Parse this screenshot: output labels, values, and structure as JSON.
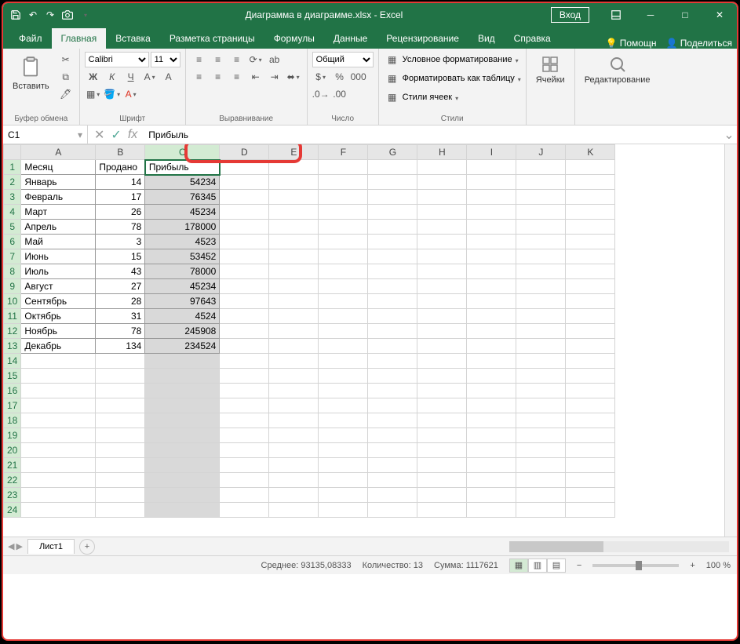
{
  "window": {
    "title": "Диаграмма в диаграмме.xlsx  -  Excel",
    "login": "Вход"
  },
  "tabs": {
    "file": "Файл",
    "home": "Главная",
    "insert": "Вставка",
    "layout": "Разметка страницы",
    "formulas": "Формулы",
    "data": "Данные",
    "review": "Рецензирование",
    "view": "Вид",
    "help": "Справка",
    "tellme": "Помощн",
    "share": "Поделиться"
  },
  "ribbon": {
    "paste": "Вставить",
    "clipboard": "Буфер обмена",
    "font_name": "Calibri",
    "font_size": "11",
    "font": "Шрифт",
    "alignment": "Выравнивание",
    "number_format": "Общий",
    "number": "Число",
    "cond_format": "Условное форматирование",
    "format_table": "Форматировать как таблицу",
    "cell_styles": "Стили ячеек",
    "styles": "Стили",
    "cells": "Ячейки",
    "editing": "Редактирование"
  },
  "formula_bar": {
    "namebox": "C1",
    "value": "Прибыль"
  },
  "columns": [
    "A",
    "B",
    "C",
    "D",
    "E",
    "F",
    "G",
    "H",
    "I",
    "J",
    "K"
  ],
  "headers": {
    "a": "Месяц",
    "b": "Продано",
    "c": "Прибыль"
  },
  "rows": [
    {
      "n": 1
    },
    {
      "n": 2,
      "a": "Январь",
      "b": "14",
      "c": "54234"
    },
    {
      "n": 3,
      "a": "Февраль",
      "b": "17",
      "c": "76345"
    },
    {
      "n": 4,
      "a": "Март",
      "b": "26",
      "c": "45234"
    },
    {
      "n": 5,
      "a": "Апрель",
      "b": "78",
      "c": "178000"
    },
    {
      "n": 6,
      "a": "Май",
      "b": "3",
      "c": "4523"
    },
    {
      "n": 7,
      "a": "Июнь",
      "b": "15",
      "c": "53452"
    },
    {
      "n": 8,
      "a": "Июль",
      "b": "43",
      "c": "78000"
    },
    {
      "n": 9,
      "a": "Август",
      "b": "27",
      "c": "45234"
    },
    {
      "n": 10,
      "a": "Сентябрь",
      "b": "28",
      "c": "97643"
    },
    {
      "n": 11,
      "a": "Октябрь",
      "b": "31",
      "c": "4524"
    },
    {
      "n": 12,
      "a": "Ноябрь",
      "b": "78",
      "c": "245908"
    },
    {
      "n": 13,
      "a": "Декабрь",
      "b": "134",
      "c": "234524"
    },
    {
      "n": 14
    },
    {
      "n": 15
    },
    {
      "n": 16
    },
    {
      "n": 17
    },
    {
      "n": 18
    },
    {
      "n": 19
    },
    {
      "n": 20
    },
    {
      "n": 21
    },
    {
      "n": 22
    },
    {
      "n": 23
    },
    {
      "n": 24
    }
  ],
  "sheet_tab": "Лист1",
  "status": {
    "avg_label": "Среднее:",
    "avg": "93135,08333",
    "count_label": "Количество:",
    "count": "13",
    "sum_label": "Сумма:",
    "sum": "1117621",
    "zoom": "100 %"
  }
}
